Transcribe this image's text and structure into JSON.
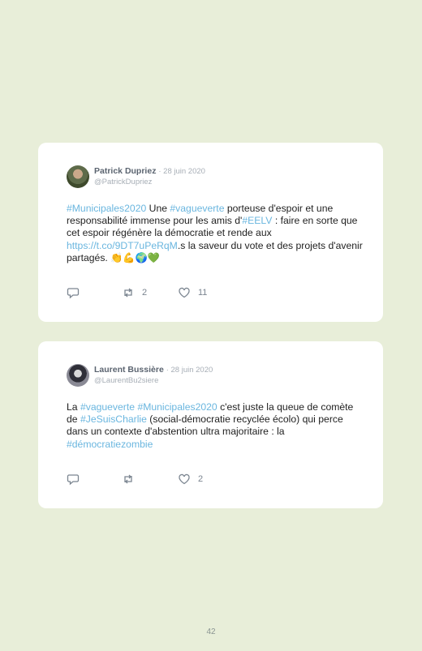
{
  "tweets": [
    {
      "author": "Patrick Dupriez",
      "date": "· 28 juin 2020",
      "handle": "@PatrickDupriez",
      "text": {
        "t1": "#Municipales2020",
        "t2": " Une ",
        "t3": "#vagueverte",
        "t4": " porteuse d'espoir et une responsabilité immense pour les amis d'",
        "t5": "#EELV",
        "t6": " : faire en sorte que cet espoir régénère la démocratie et rende aux ",
        "t7": "https://t.co/9DT7uPeRqM",
        "t8": ".s la saveur du vote et des projets d'avenir partagés. ",
        "t9": "👏💪🌍💚"
      },
      "retweets": "2",
      "likes": "11"
    },
    {
      "author": "Laurent Bussière",
      "date": "· 28 juin 2020",
      "handle": "@LaurentBu2siere",
      "text": {
        "t1": "La ",
        "t2": "#vagueverte",
        "t3": " ",
        "t4": "#Municipales2020",
        "t5": " c'est juste la queue de comète de ",
        "t6": "#JeSuisCharlie",
        "t7": " (social-démocratie recyclée écolo) qui perce dans un contexte d'abstention ultra majoritaire : la ",
        "t8": "#démocratiezombie"
      },
      "retweets": "",
      "likes": "2"
    }
  ],
  "colors": {
    "background": "#e8eed9",
    "card": "#ffffff",
    "hashtag": "#6ab6df"
  },
  "icons": [
    "reply-icon",
    "retweet-icon",
    "heart-icon"
  ],
  "page_number": "42"
}
